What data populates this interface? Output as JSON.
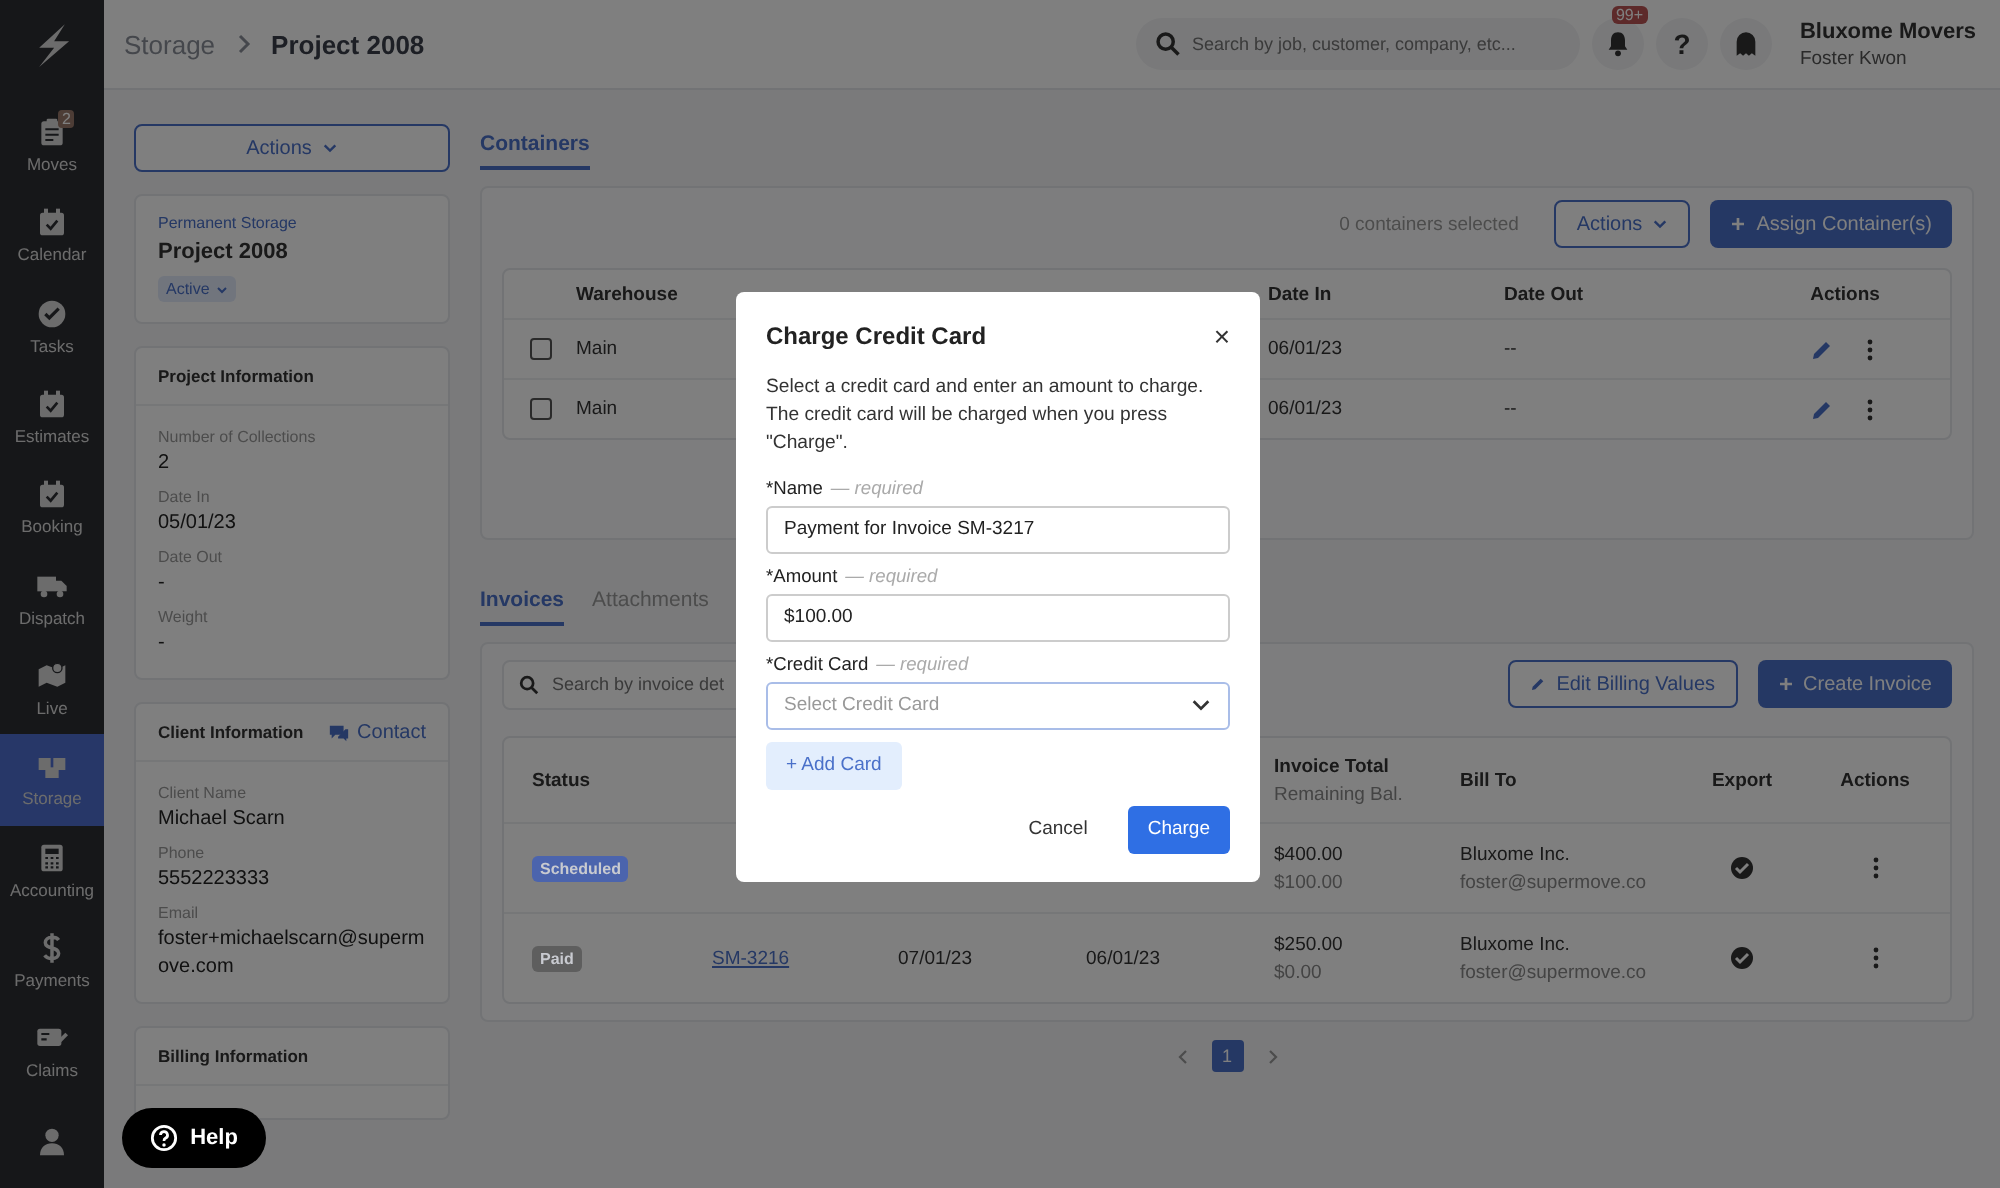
{
  "sidebar": {
    "items": [
      {
        "kind": "moves",
        "label": "Moves",
        "badge": "2",
        "selected": false
      },
      {
        "kind": "calendar",
        "label": "Calendar",
        "selected": false
      },
      {
        "kind": "tasks",
        "label": "Tasks",
        "selected": false
      },
      {
        "kind": "calendar",
        "label": "Estimates",
        "selected": false
      },
      {
        "kind": "calendar",
        "label": "Booking",
        "selected": false
      },
      {
        "kind": "truck",
        "label": "Dispatch",
        "selected": false
      },
      {
        "kind": "map",
        "label": "Live",
        "selected": false
      },
      {
        "kind": "boxes",
        "label": "Storage",
        "selected": true
      },
      {
        "kind": "calculator",
        "label": "Accounting",
        "selected": false
      },
      {
        "kind": "dollar",
        "label": "Payments",
        "selected": false
      },
      {
        "kind": "card",
        "label": "Claims",
        "selected": false
      },
      {
        "kind": "user",
        "selected": false
      }
    ]
  },
  "header": {
    "breadcrumb": [
      "Storage",
      "Project 2008"
    ],
    "search": {
      "placeholder": "Search by job, customer, company, etc..."
    },
    "notification_badge": "99+",
    "help": "?",
    "company": "Bluxome Movers",
    "user": "Foster Kwon"
  },
  "project_panel": {
    "actions": "Actions",
    "type": "Permanent Storage",
    "name": "Project 2008",
    "status": "Active",
    "sections": [
      {
        "title": "Project Information",
        "fields": [
          {
            "label": "Number of Collections",
            "value": "2"
          },
          {
            "label": "Date In",
            "value": "05/01/23"
          },
          {
            "label": "Date Out",
            "value": "-"
          },
          {
            "label": "Weight",
            "value": "-"
          }
        ]
      },
      {
        "title": "Client Information",
        "link": "Contact",
        "fields": [
          {
            "label": "Client Name",
            "value": "Michael Scarn"
          },
          {
            "label": "Phone",
            "value": "5552223333"
          },
          {
            "label": "Email",
            "value": "foster+michaelscarn@supermove.com"
          }
        ]
      },
      {
        "title": "Billing Information"
      }
    ]
  },
  "containers": {
    "tabs": [
      {
        "label": "Containers",
        "selected": true
      }
    ],
    "selected_count": "0 containers selected",
    "actions": "Actions",
    "assign": "Assign Container(s)",
    "columns": [
      "Warehouse",
      "Date In",
      "Date Out",
      "Actions"
    ],
    "rows": [
      {
        "checked": false,
        "warehouse": "Main",
        "date_in": "06/01/23",
        "date_out": "--"
      },
      {
        "checked": false,
        "warehouse": "Main",
        "date_in": "06/01/23",
        "date_out": "--"
      }
    ]
  },
  "invoices": {
    "tabs": [
      {
        "label": "Invoices",
        "selected": true
      },
      {
        "label": "Attachments",
        "selected": false
      }
    ],
    "search": {
      "placeholder": "Search by invoice det"
    },
    "edit_billing": "Edit Billing Values",
    "create": "Create Invoice",
    "columns": [
      "Status",
      "Invoice Total",
      "Remaining Bal.",
      "Bill To",
      "Export",
      "Actions"
    ],
    "rows": [
      {
        "status": "Scheduled",
        "color": "#4b64ad",
        "total": "$400.00",
        "remaining": "$100.00",
        "bill_to": "Bluxome Inc.",
        "email": "foster@supermove.co",
        "exported": true
      },
      {
        "status": "Paid",
        "color": "#5e5e5e",
        "invoice": "SM-3216",
        "date_1": "07/01/23",
        "date_2": "06/01/23",
        "total": "$250.00",
        "remaining": "$0.00",
        "bill_to": "Bluxome Inc.",
        "email": "foster@supermove.co",
        "exported": true
      }
    ],
    "pages": [
      {
        "label": "1",
        "selected": true
      }
    ]
  },
  "help_button": "Help",
  "modal": {
    "title": "Charge Credit Card",
    "close": "×",
    "description": "Select a credit card and enter an amount to charge. The credit card will be charged when you press \"Charge\".",
    "fields": [
      {
        "kind": "text",
        "label": "*Name",
        "note": "— required",
        "value": "Payment for Invoice SM-3217"
      },
      {
        "kind": "text",
        "label": "*Amount",
        "note": "— required",
        "value": "$100.00"
      },
      {
        "kind": "select",
        "label": "*Credit Card",
        "note": "— required",
        "placeholder": "Select Credit Card"
      }
    ],
    "add_card": "+ Add Card",
    "cancel": "Cancel",
    "confirm": "Charge"
  }
}
